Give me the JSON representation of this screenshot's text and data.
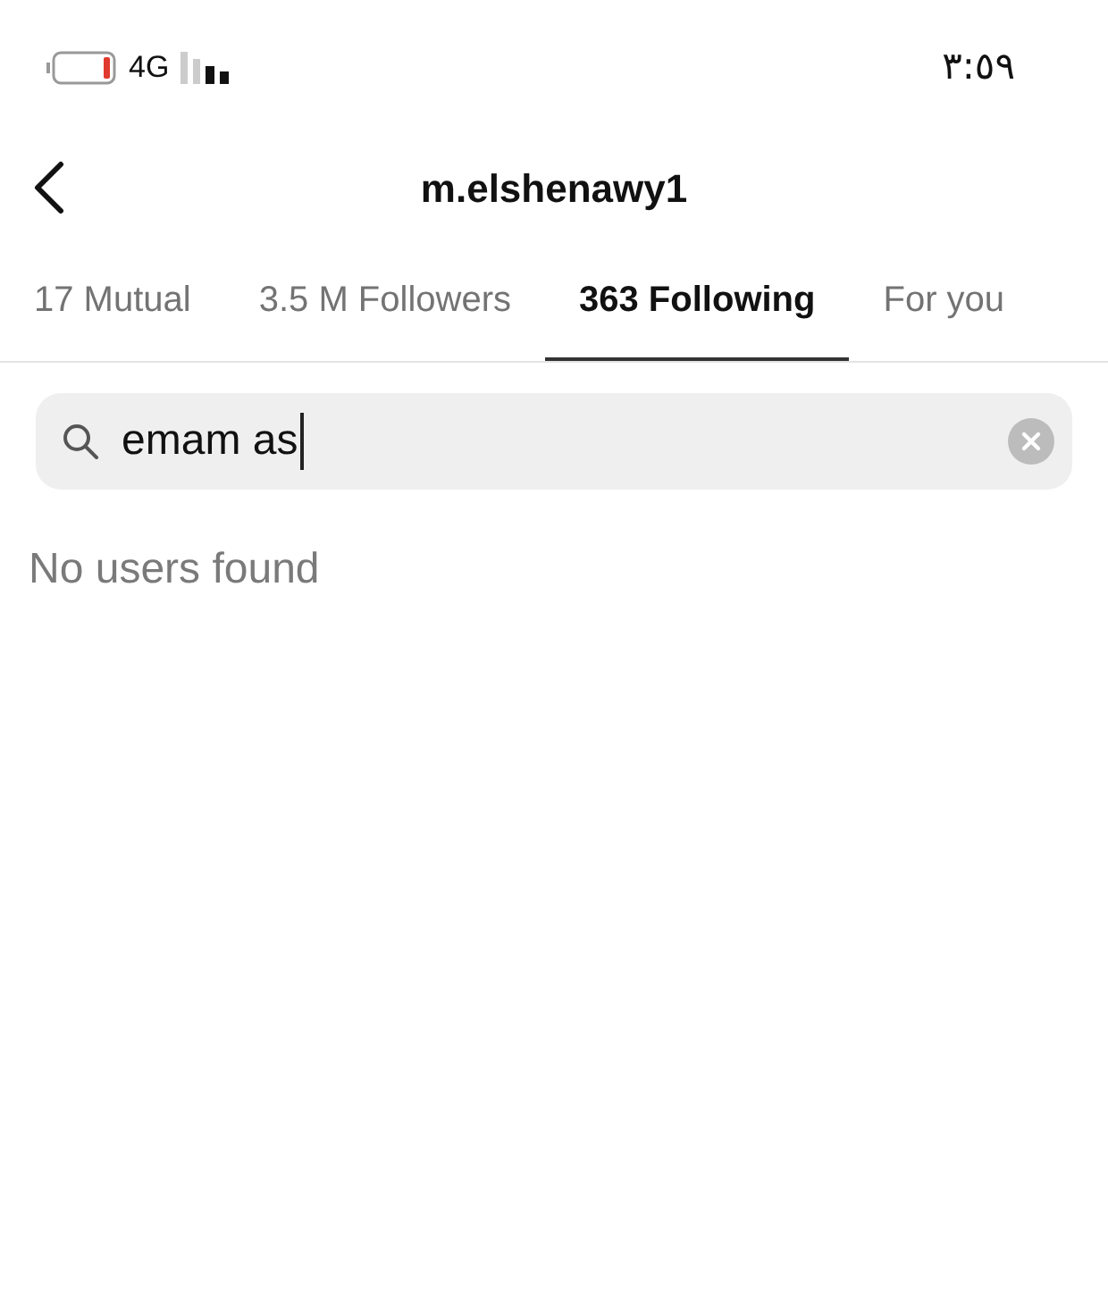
{
  "status_bar": {
    "network": "4G",
    "time": "٣:٥٩"
  },
  "header": {
    "title": "m.elshenawy1"
  },
  "tabs": [
    {
      "label": "17 Mutual",
      "selected": false
    },
    {
      "label": "3.5 M Followers",
      "selected": false
    },
    {
      "label": "363 Following",
      "selected": true
    },
    {
      "label": "For you",
      "selected": false
    }
  ],
  "search": {
    "value": "emam as"
  },
  "message": "No users found"
}
